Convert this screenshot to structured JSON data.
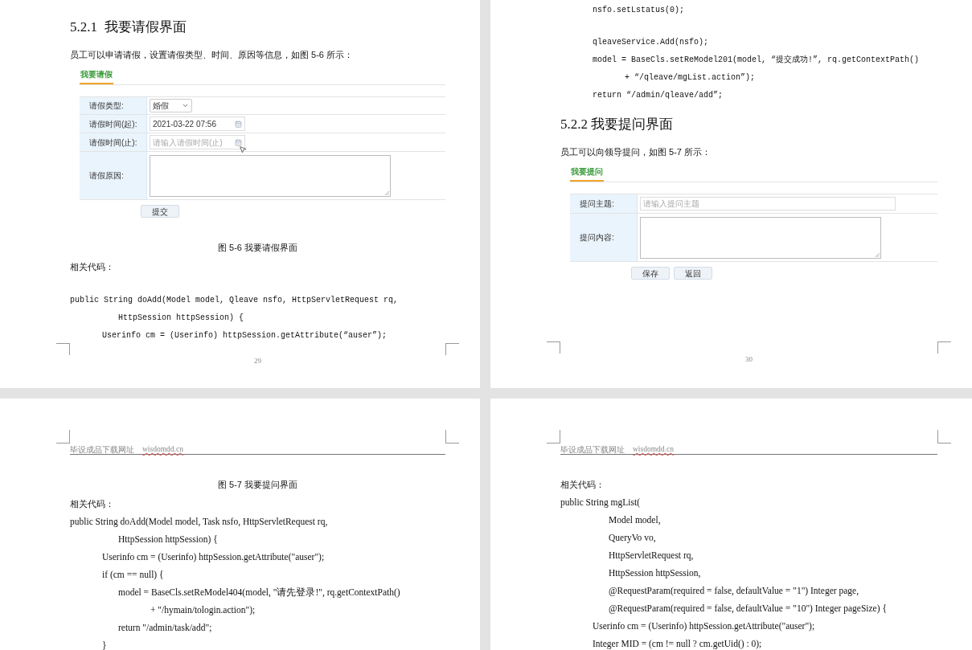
{
  "rows": [
    {
      "pages": [
        {
          "page_number": "29",
          "blocks": [
            {
              "kind": "heading",
              "text": "5.2.1  我要请假界面"
            },
            {
              "kind": "paragraph",
              "text": "员工可以申请请假，设置请假类型、时间、原因等信息，如图 5-6 所示："
            },
            {
              "kind": "form",
              "tab": {
                "label": "我要请假",
                "selected": true
              },
              "fields": [
                {
                  "label": "请假类型:",
                  "kind": "select",
                  "value": "婚假"
                },
                {
                  "label": "请假时间(起):",
                  "kind": "date",
                  "value": "2021-03-22 07:56"
                },
                {
                  "label": "请假时间(止):",
                  "kind": "date",
                  "placeholder": "请输入请假时间(止)"
                },
                {
                  "label": "请假原因:",
                  "kind": "textarea"
                }
              ],
              "buttons": [
                "提交"
              ]
            },
            {
              "kind": "caption",
              "text": "图 5-6 我要请假界面"
            },
            {
              "kind": "label",
              "text": "相关代码："
            },
            {
              "kind": "code",
              "lines": [
                "public String doAdd(Model model, Qleave nsfo, HttpServletRequest rq,",
                "      HttpSession httpSession) {",
                "    Userinfo cm = (Userinfo) httpSession.getAttribute(“auser”);"
              ]
            }
          ]
        },
        {
          "page_number": "30",
          "blocks": [
            {
              "kind": "code",
              "lines": [
                "    nsfo.setLstatus(0);"
              ]
            },
            {
              "kind": "code",
              "lines": [
                "    qleaveService.Add(nsfo);",
                "    model = BaseCls.setReModel201(model, “提交成功!”, rq.getContextPath()",
                "        + “/qleave/mgList.action”);",
                "    return “/admin/qleave/add”;"
              ]
            },
            {
              "kind": "heading",
              "text": "5.2.2 我要提问界面"
            },
            {
              "kind": "paragraph",
              "text": "员工可以向领导提问，如图 5-7 所示："
            },
            {
              "kind": "form",
              "tab": {
                "label": "我要提问",
                "selected": true
              },
              "fields": [
                {
                  "label": "提问主题:",
                  "kind": "text",
                  "placeholder": "请输入提问主题"
                },
                {
                  "label": "提问内容:",
                  "kind": "textarea"
                }
              ],
              "buttons": [
                "保存",
                "返回"
              ]
            }
          ]
        }
      ]
    },
    {
      "pages": [
        {
          "header": {
            "label": "毕设成品下载网址",
            "url": "wisdomdd.cn"
          },
          "blocks": [
            {
              "kind": "caption",
              "text": "图 5-7 我要提问界面"
            },
            {
              "kind": "label",
              "text": "相关代码："
            },
            {
              "kind": "listing",
              "lines": [
                "public String doAdd(Model model, Task nsfo, HttpServletRequest rq,",
                "      HttpSession httpSession) {",
                "    Userinfo cm = (Userinfo) httpSession.getAttribute(\"auser\");",
                "    if (cm == null) {",
                "      model = BaseCls.setReModel404(model, \"请先登录!\", rq.getContextPath()",
                "          + \"/hymain/tologin.action\");",
                "      return \"/admin/task/add\";",
                "    }"
              ]
            }
          ]
        },
        {
          "header": {
            "label": "毕设成品下载网址",
            "url": "wisdomdd.cn"
          },
          "blocks": [
            {
              "kind": "label",
              "text": "相关代码："
            },
            {
              "kind": "listing",
              "lines": [
                "public String mgList(",
                "      Model model,",
                "      QueryVo vo,",
                "      HttpServletRequest rq,",
                "      HttpSession httpSession,",
                "      @RequestParam(required = false, defaultValue = \"1\") Integer page,",
                "      @RequestParam(required = false, defaultValue = \"10\") Integer pageSize) {",
                "    Userinfo cm = (Userinfo) httpSession.getAttribute(\"auser\");",
                "    Integer MID = (cm != null ? cm.getUid() : 0);"
              ]
            }
          ]
        }
      ]
    }
  ]
}
